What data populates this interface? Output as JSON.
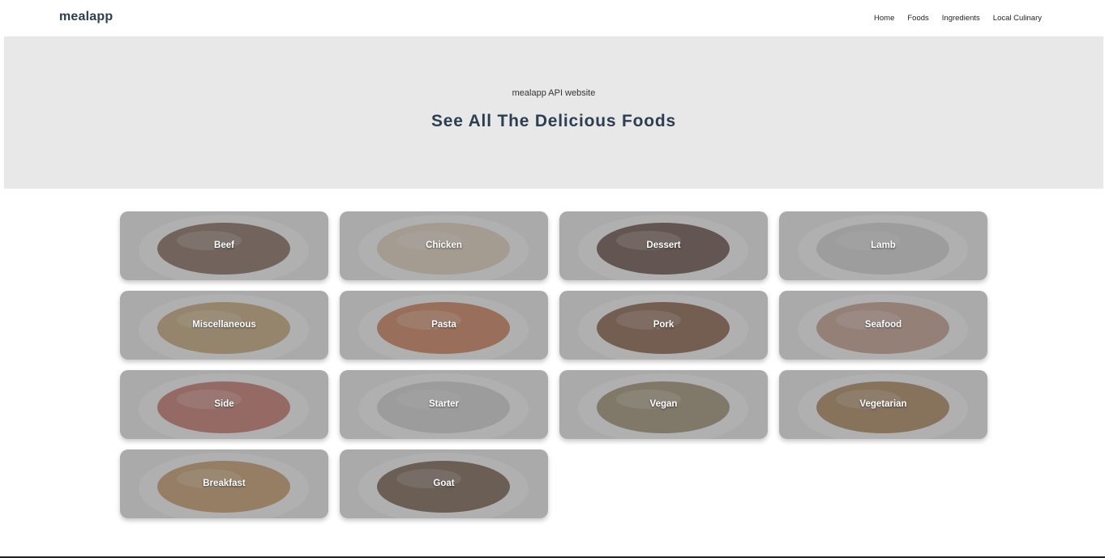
{
  "navbar": {
    "brand": "mealapp",
    "links": [
      {
        "label": "Home"
      },
      {
        "label": "Foods"
      },
      {
        "label": "Ingredients"
      },
      {
        "label": "Local Culinary"
      }
    ]
  },
  "hero": {
    "subtitle": "mealapp API website",
    "title": "See All The Delicious Foods"
  },
  "categories": [
    {
      "label": "Beef",
      "icon": "beef-image",
      "color": "#6b4a3a"
    },
    {
      "label": "Chicken",
      "icon": "chicken-image",
      "color": "#d9c6b0"
    },
    {
      "label": "Dessert",
      "icon": "dessert-image",
      "color": "#4a2e24"
    },
    {
      "label": "Lamb",
      "icon": "lamb-image",
      "color": "#c9c9c9"
    },
    {
      "label": "Miscellaneous",
      "icon": "tacos-image",
      "color": "#b8955e"
    },
    {
      "label": "Pasta",
      "icon": "pasta-image",
      "color": "#c2643a"
    },
    {
      "label": "Pork",
      "icon": "pork-image",
      "color": "#6d3e22"
    },
    {
      "label": "Seafood",
      "icon": "seafood-image",
      "color": "#b98a78"
    },
    {
      "label": "Side",
      "icon": "side-image",
      "color": "#b95a4e"
    },
    {
      "label": "Starter",
      "icon": "starter-image",
      "color": "#c7c7c7"
    },
    {
      "label": "Vegan",
      "icon": "vegan-image",
      "color": "#8a7a5a"
    },
    {
      "label": "Vegetarian",
      "icon": "vegetarian-image",
      "color": "#9a6a3a"
    },
    {
      "label": "Breakfast",
      "icon": "breakfast-image",
      "color": "#b8864a"
    },
    {
      "label": "Goat",
      "icon": "goat-image",
      "color": "#5a3e2a"
    }
  ]
}
